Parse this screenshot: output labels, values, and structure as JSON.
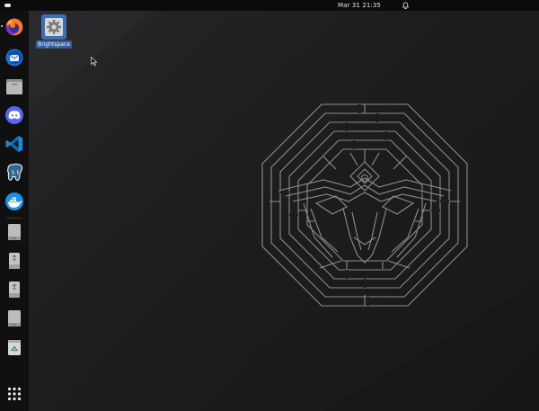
{
  "topbar": {
    "date": "Mar 31",
    "time": "21:35",
    "clock_text": "Mar 31  21:35"
  },
  "dock": {
    "items": [
      {
        "name": "firefox",
        "icon": "firefox-icon"
      },
      {
        "name": "thunderbird",
        "icon": "thunderbird-icon"
      },
      {
        "name": "files",
        "icon": "folder-icon"
      },
      {
        "name": "discord",
        "icon": "discord-icon"
      },
      {
        "name": "vscode",
        "icon": "vscode-icon"
      },
      {
        "name": "postgresql",
        "icon": "postgresql-icon"
      },
      {
        "name": "docker",
        "icon": "docker-icon"
      },
      {
        "name": "drive-1",
        "icon": "drive-icon"
      },
      {
        "name": "usb-1",
        "icon": "usb-drive-icon"
      },
      {
        "name": "usb-2",
        "icon": "usb-drive-icon"
      },
      {
        "name": "drive-2",
        "icon": "drive-icon"
      },
      {
        "name": "trash",
        "icon": "trash-icon"
      }
    ],
    "show_apps_icon": "app-grid-icon"
  },
  "desktop": {
    "icons": [
      {
        "label": "Brightspace",
        "icon": "gear-icon"
      }
    ]
  },
  "colors": {
    "accent": "#3c6fb5",
    "wallpaper": "#1c1c1e",
    "dock": "#101010",
    "topbar": "#0b0b0b"
  }
}
